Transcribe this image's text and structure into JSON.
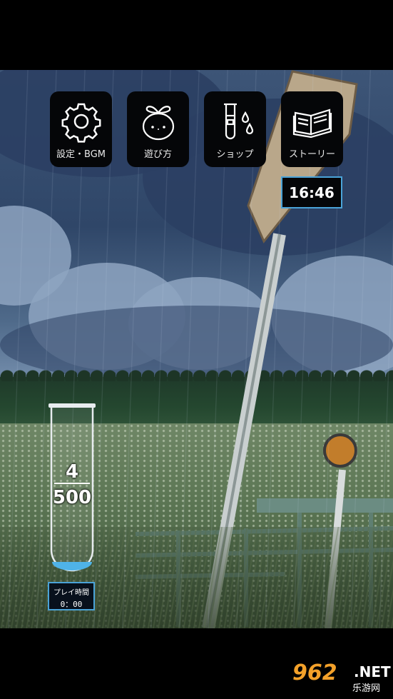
{
  "menu": {
    "settings": {
      "label": "設定・BGM",
      "icon": "gear-icon"
    },
    "howto": {
      "label": "遊び方",
      "icon": "sprout-face-icon"
    },
    "shop": {
      "label": "ショップ",
      "icon": "test-tube-drops-icon"
    },
    "story": {
      "label": "ストーリー",
      "icon": "open-book-icon"
    }
  },
  "clock": {
    "time": "16:46"
  },
  "tube": {
    "current": "4",
    "goal": "500",
    "fill_fraction": 0.008,
    "liquid_color": "#4fb3e8"
  },
  "playtime": {
    "label": "プレイ時間",
    "value": "0：00"
  },
  "watermark": {
    "number": "962",
    "suffix": ".NET",
    "subtitle": "乐游网"
  },
  "colors": {
    "accent_border": "#4aa3d8",
    "button_bg": "#050608"
  }
}
